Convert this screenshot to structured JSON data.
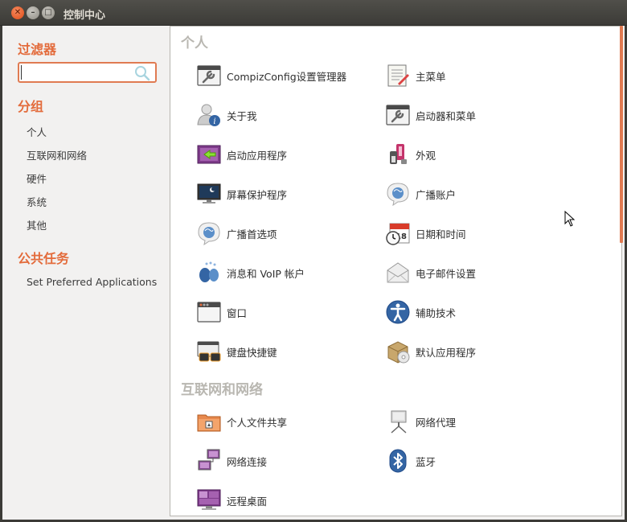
{
  "window": {
    "title": "控制中心",
    "close_glyph": "✕",
    "min_glyph": "–",
    "max_glyph": "□"
  },
  "sidebar": {
    "filter_heading": "过滤器",
    "search": {
      "value": "",
      "placeholder": ""
    },
    "groups_heading": "分组",
    "groups": [
      {
        "label": "个人"
      },
      {
        "label": "互联网和网络"
      },
      {
        "label": "硬件"
      },
      {
        "label": "系统"
      },
      {
        "label": "其他"
      }
    ],
    "tasks_heading": "公共任务",
    "tasks": [
      {
        "label": "Set Preferred Applications"
      }
    ]
  },
  "content": {
    "categories": [
      {
        "heading": "个人",
        "items": [
          {
            "label": "CompizConfig设置管理器",
            "icon": "wrench-settings-icon"
          },
          {
            "label": "主菜单",
            "icon": "main-menu-icon"
          },
          {
            "label": "关于我",
            "icon": "about-me-icon"
          },
          {
            "label": "启动器和菜单",
            "icon": "launcher-menu-icon"
          },
          {
            "label": "启动应用程序",
            "icon": "startup-apps-icon"
          },
          {
            "label": "外观",
            "icon": "appearance-icon"
          },
          {
            "label": "屏幕保护程序",
            "icon": "screensaver-icon"
          },
          {
            "label": "广播账户",
            "icon": "broadcast-accounts-icon"
          },
          {
            "label": "广播首选项",
            "icon": "broadcast-preferences-icon"
          },
          {
            "label": "日期和时间",
            "icon": "calendar-clock-icon"
          },
          {
            "label": "消息和 VoIP 帐户",
            "icon": "messaging-icon"
          },
          {
            "label": "电子邮件设置",
            "icon": "email-icon"
          },
          {
            "label": "窗口",
            "icon": "window-icon"
          },
          {
            "label": "辅助技术",
            "icon": "accessibility-icon"
          },
          {
            "label": "键盘快捷键",
            "icon": "keyboard-shortcuts-icon"
          },
          {
            "label": "默认应用程序",
            "icon": "default-apps-icon"
          }
        ]
      },
      {
        "heading": "互联网和网络",
        "items": [
          {
            "label": "个人文件共享",
            "icon": "file-sharing-icon"
          },
          {
            "label": "网络代理",
            "icon": "network-proxy-icon"
          },
          {
            "label": "网络连接",
            "icon": "network-connections-icon"
          },
          {
            "label": "蓝牙",
            "icon": "bluetooth-icon"
          },
          {
            "label": "远程桌面",
            "icon": "remote-desktop-icon"
          }
        ]
      }
    ]
  },
  "colors": {
    "accent": "#e36b3b",
    "heading_gray": "#b9b7b1",
    "titlebar": "#3c3b37"
  }
}
